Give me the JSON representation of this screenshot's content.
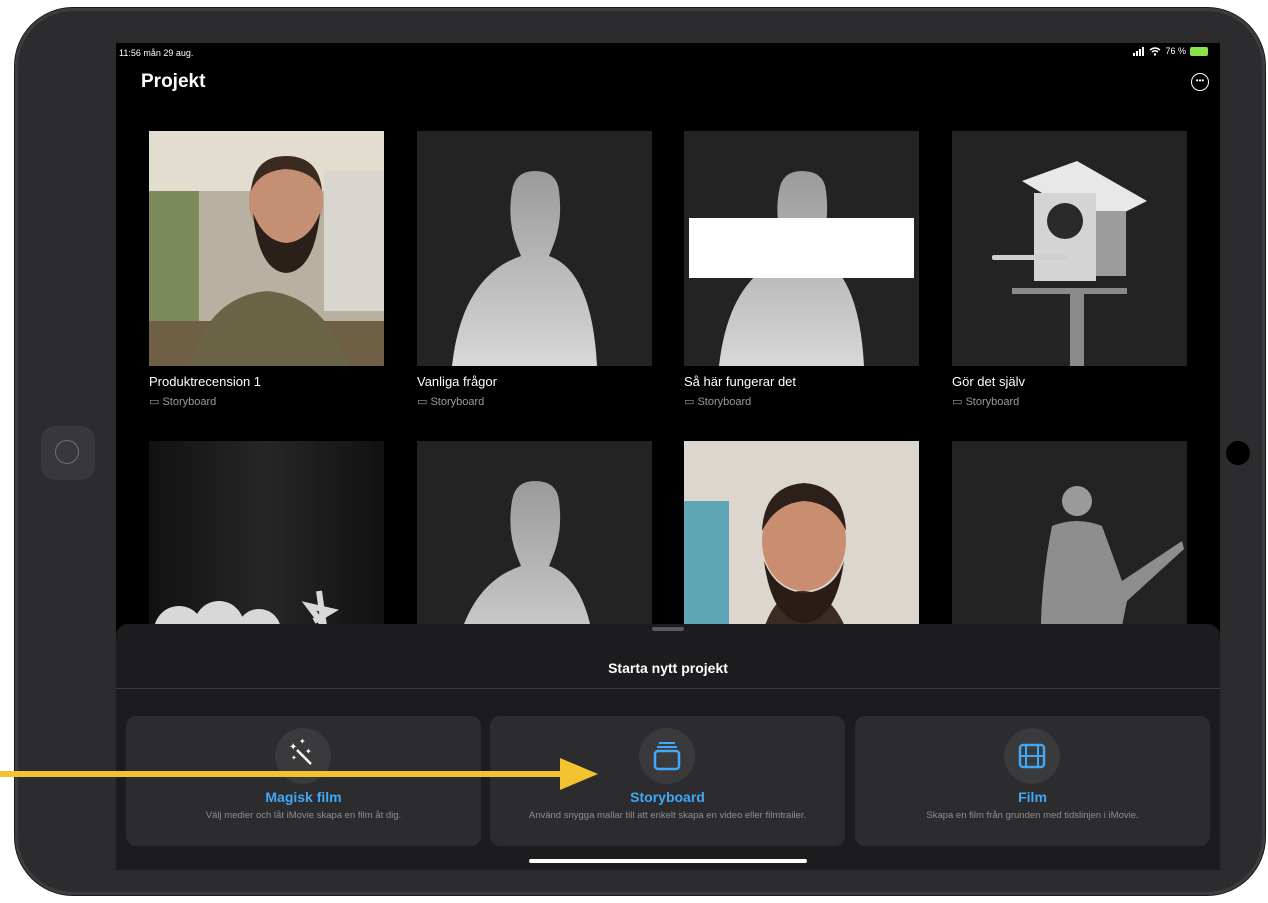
{
  "status_bar": {
    "time": "11:56  mån 29 aug.",
    "battery": "76 %"
  },
  "header": {
    "title": "Projekt"
  },
  "projects": [
    {
      "title": "Produktrecension 1",
      "type": "Storyboard"
    },
    {
      "title": "Vanliga frågor",
      "type": "Storyboard"
    },
    {
      "title": "Så här fungerar det",
      "type": "Storyboard"
    },
    {
      "title": "Gör det själv",
      "type": "Storyboard"
    }
  ],
  "sheet": {
    "title": "Starta nytt projekt",
    "options": [
      {
        "name": "Magisk film",
        "description": "Välj medier och låt iMovie skapa en film åt dig.",
        "icon": "magic-wand-icon"
      },
      {
        "name": "Storyboard",
        "description": "Använd snygga mallar till att enkelt skapa en video eller filmtrailer.",
        "icon": "storyboard-icon"
      },
      {
        "name": "Film",
        "description": "Skapa en film från grunden med tidslinjen i iMovie.",
        "icon": "film-icon"
      }
    ]
  },
  "colors": {
    "accent": "#3fa9f5",
    "annotation_arrow": "#f2c230"
  }
}
